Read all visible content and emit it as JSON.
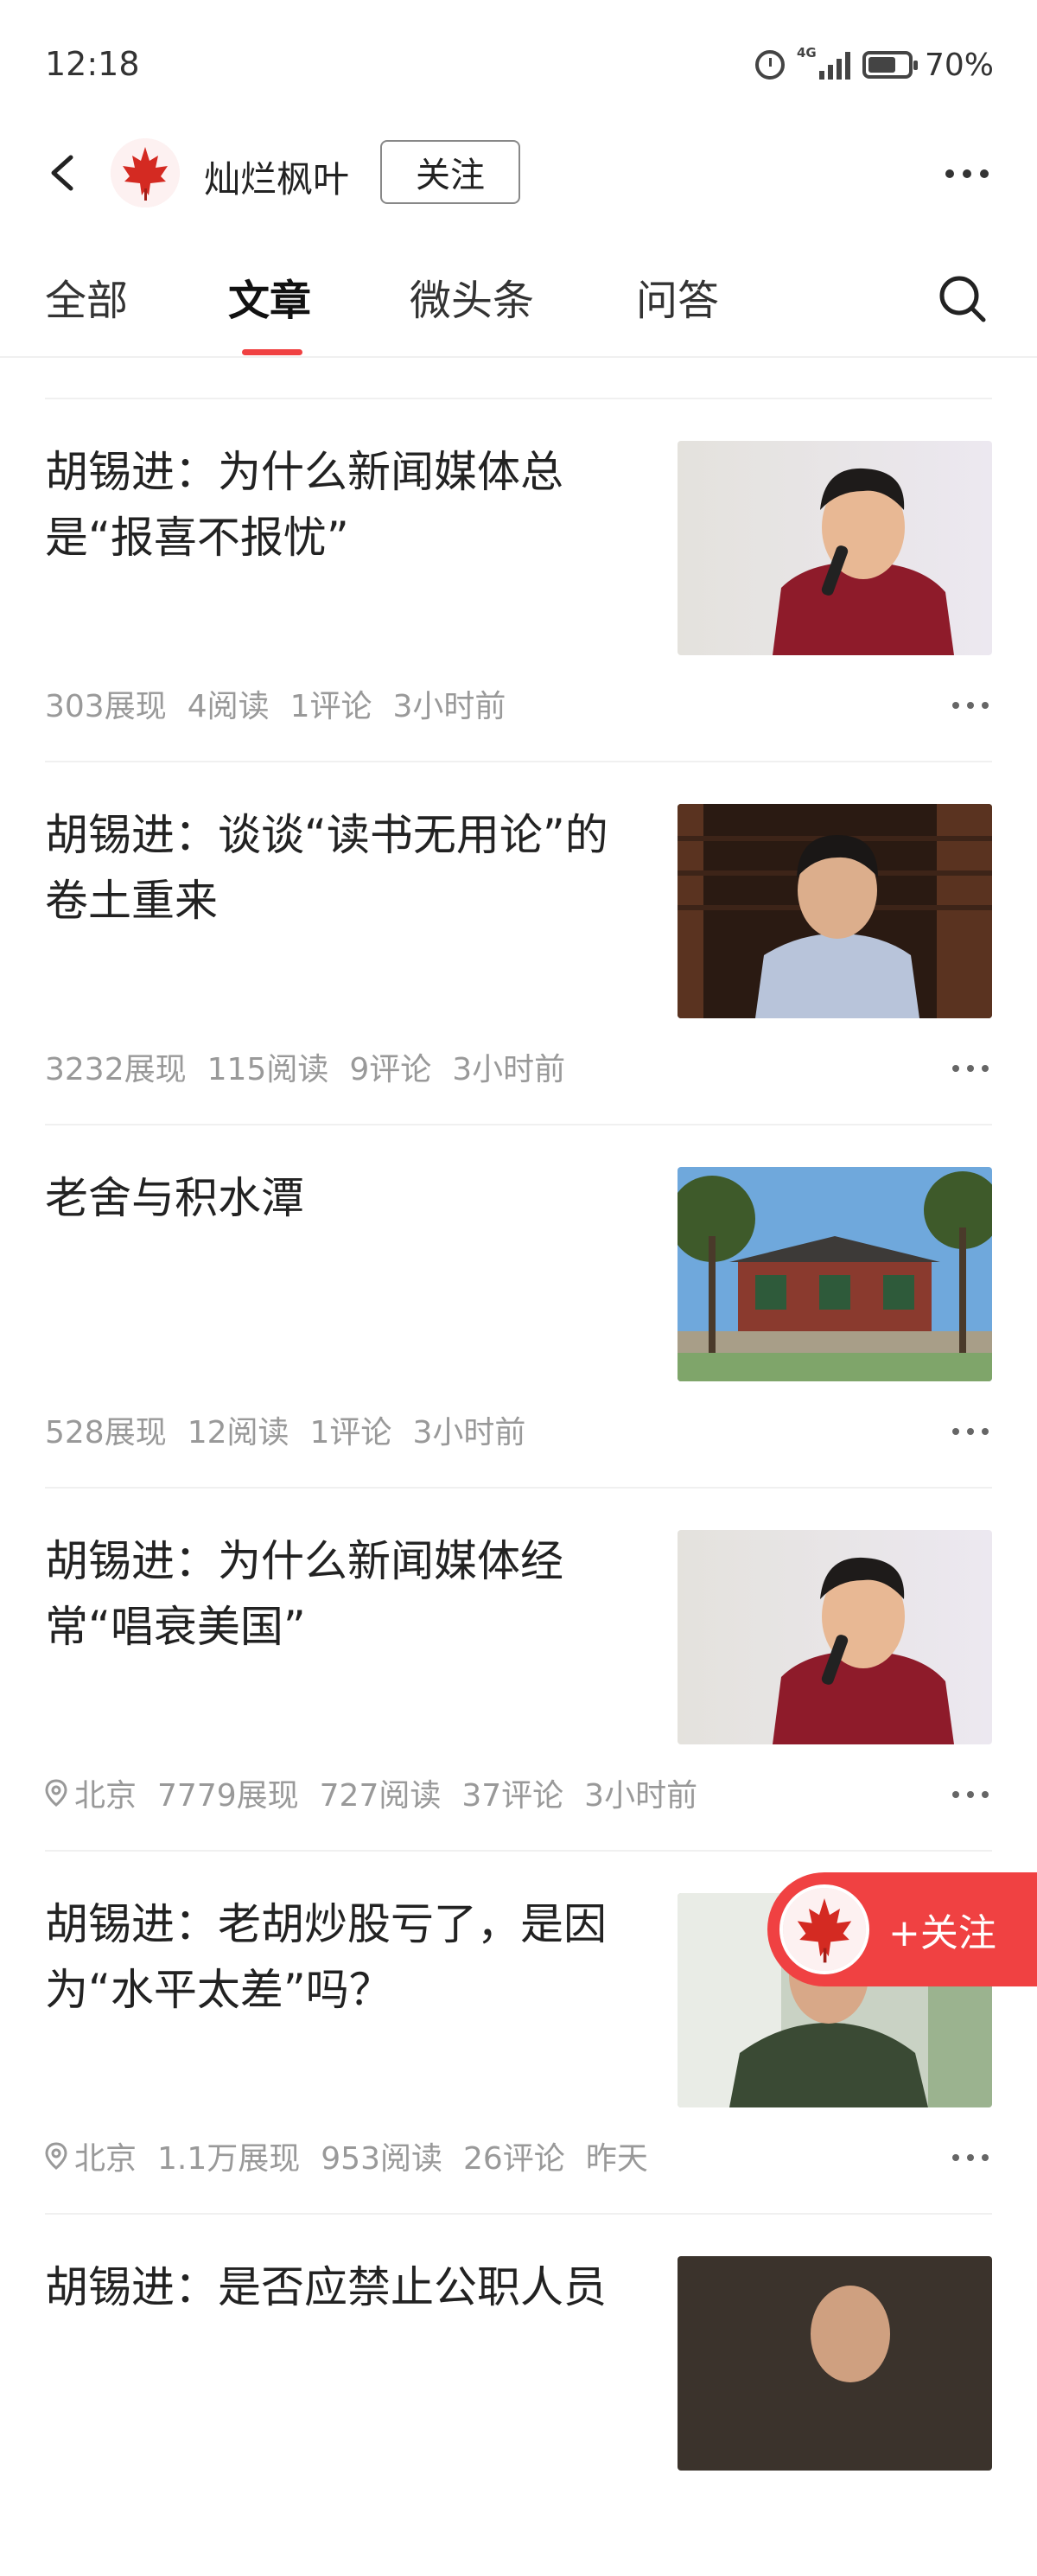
{
  "status_bar": {
    "time": "12:18",
    "network": "4G",
    "battery_percent": "70%",
    "battery_level": 0.7
  },
  "header": {
    "author_name": "灿烂枫叶",
    "follow_label": "关注"
  },
  "tabs": [
    {
      "label": "全部"
    },
    {
      "label": "文章",
      "active": true
    },
    {
      "label": "微头条"
    },
    {
      "label": "问答"
    }
  ],
  "articles": [
    {
      "title": "胡锡进：为什么新闻媒体总是“报喜不报忧”",
      "views": "303展现",
      "reads": "4阅读",
      "comments": "1评论",
      "time": "3小时前"
    },
    {
      "title": "胡锡进：谈谈“读书无用论”的卷土重来",
      "views": "3232展现",
      "reads": "115阅读",
      "comments": "9评论",
      "time": "3小时前"
    },
    {
      "title": "老舍与积水潭",
      "views": "528展现",
      "reads": "12阅读",
      "comments": "1评论",
      "time": "3小时前"
    },
    {
      "title": "胡锡进：为什么新闻媒体经常“唱衰美国”",
      "location": "北京",
      "views": "7779展现",
      "reads": "727阅读",
      "comments": "37评论",
      "time": "3小时前"
    },
    {
      "title": "胡锡进：老胡炒股亏了，是因为“水平太差”吗？",
      "location": "北京",
      "views": "1.1万展现",
      "reads": "953阅读",
      "comments": "26评论",
      "time": "昨天"
    },
    {
      "title": "胡锡进：是否应禁止公职人员"
    }
  ],
  "floating_follow": {
    "label": "+关注"
  },
  "colors": {
    "accent": "#f04142",
    "meta_text": "#999999",
    "divider": "#f0f0f0"
  }
}
